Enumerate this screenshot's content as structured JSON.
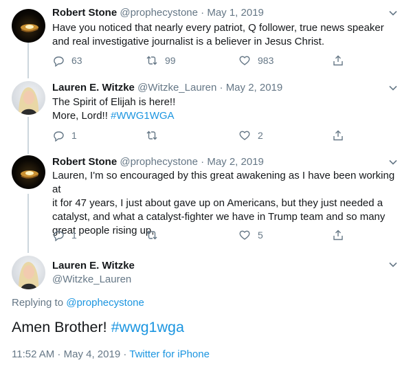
{
  "tweets": [
    {
      "author": "Robert Stone",
      "handle": "@prophecystone",
      "sep": "·",
      "date": "May 1, 2019",
      "text_lines": [
        "Have you noticed that nearly every patriot, Q follower, true news speaker",
        "and real investigative journalist is a believer in Jesus Christ."
      ],
      "replies": "63",
      "retweets": "99",
      "likes": "983"
    },
    {
      "author": "Lauren E. Witzke",
      "handle": "@Witzke_Lauren",
      "sep": "·",
      "date": "May 2, 2019",
      "line1": "The Spirit of Elijah is here!!",
      "line2_prefix": "More, Lord!! ",
      "line2_hashtag": "#WWG1WGA",
      "replies": "1",
      "retweets": "",
      "likes": "2"
    },
    {
      "author": "Robert Stone",
      "handle": "@prophecystone",
      "sep": "·",
      "date": "May 2, 2019",
      "text_lines": [
        "Lauren, I'm so encouraged by this great awakening as I have been working at",
        "it for 47 years, I just about gave up on Americans, but they just needed a",
        "catalyst, and what a catalyst-fighter we have in Trump team and so many",
        "great people rising up,"
      ],
      "replies": "1",
      "retweets": "",
      "likes": "5"
    }
  ],
  "main_tweet": {
    "author": "Lauren E. Witzke",
    "handle": "@Witzke_Lauren",
    "replying_prefix": "Replying to ",
    "replying_to": "@prophecystone",
    "text_prefix": "Amen Brother! ",
    "text_hashtag": "#wwg1wga",
    "time": "11:52 AM",
    "meta_sep": " · ",
    "date": "May 4, 2019",
    "source": "Twitter for iPhone"
  },
  "colors": {
    "link": "#1b95e0",
    "muted": "#657786",
    "thread_line": "#ccd6dd"
  },
  "icons": {
    "reply": "reply-icon",
    "retweet": "retweet-icon",
    "like": "heart-icon",
    "share": "share-icon",
    "caret": "chevron-down-icon"
  }
}
